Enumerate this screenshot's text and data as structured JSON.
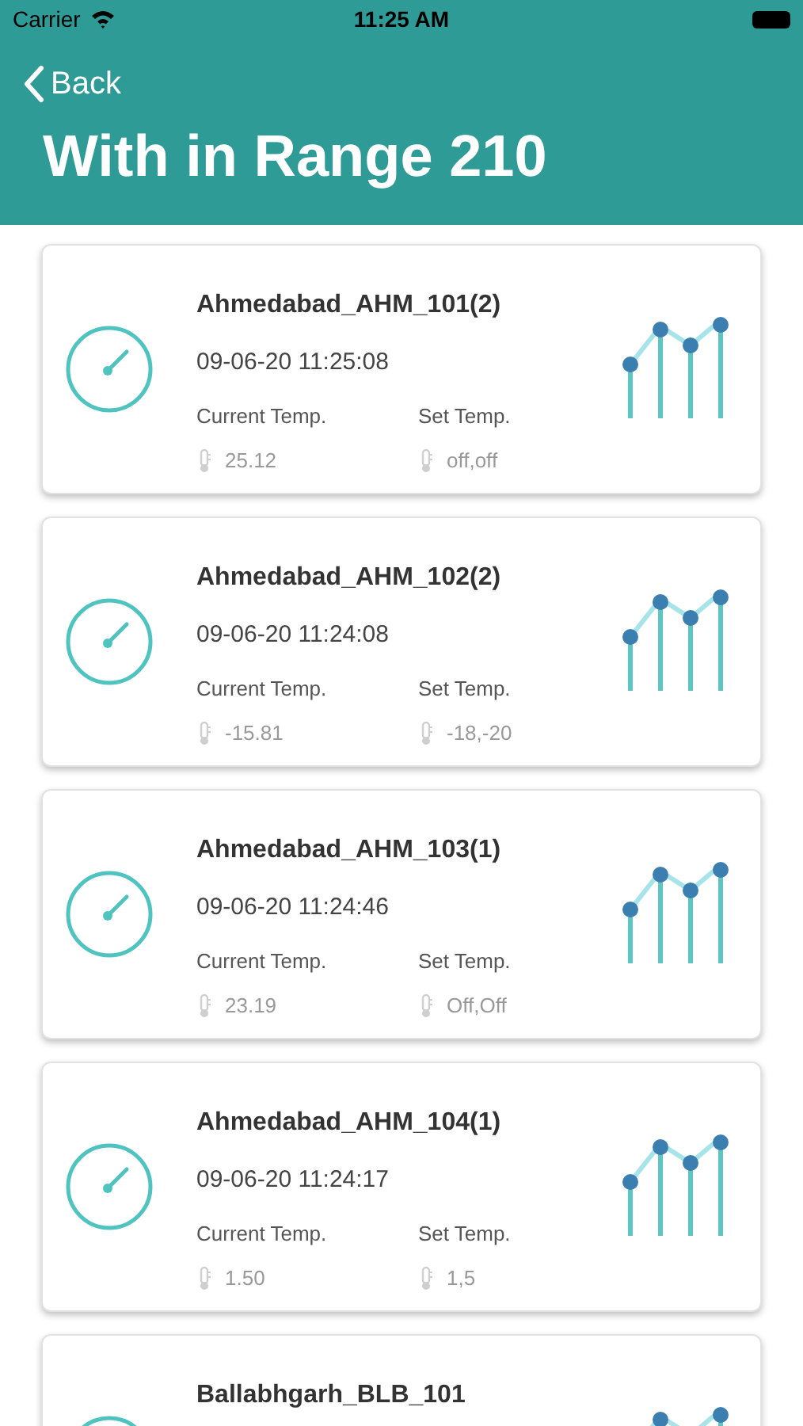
{
  "status_bar": {
    "carrier": "Carrier",
    "time": "11:25 AM"
  },
  "nav": {
    "back": "Back",
    "title": "With in Range 210"
  },
  "cards": [
    {
      "name": "Ahmedabad_AHM_101(2)",
      "timestamp": "09-06-20 11:25:08",
      "current_label": "Current Temp.",
      "current_value": "25.12",
      "set_label": "Set Temp.",
      "set_value": "off,off"
    },
    {
      "name": "Ahmedabad_AHM_102(2)",
      "timestamp": "09-06-20 11:24:08",
      "current_label": "Current Temp.",
      "current_value": "-15.81",
      "set_label": "Set Temp.",
      "set_value": "-18,-20"
    },
    {
      "name": "Ahmedabad_AHM_103(1)",
      "timestamp": "09-06-20 11:24:46",
      "current_label": "Current Temp.",
      "current_value": "23.19",
      "set_label": "Set Temp.",
      "set_value": "Off,Off"
    },
    {
      "name": "Ahmedabad_AHM_104(1)",
      "timestamp": "09-06-20 11:24:17",
      "current_label": "Current Temp.",
      "current_value": "1.50",
      "set_label": "Set Temp.",
      "set_value": "1,5"
    },
    {
      "name": "Ballabhgarh_BLB_101"
    }
  ]
}
